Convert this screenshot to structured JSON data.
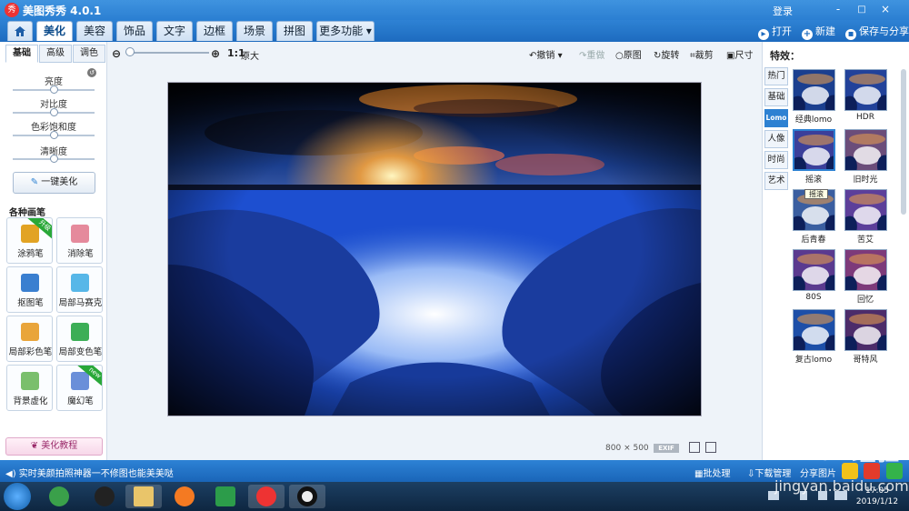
{
  "app": {
    "title": "美图秀秀 4.0.1",
    "logo": "秀",
    "login": "登录",
    "window_controls": [
      "-",
      "□",
      "×"
    ]
  },
  "topbar": {
    "tabs": [
      "美化",
      "美容",
      "饰品",
      "文字",
      "边框",
      "场景",
      "拼图",
      "更多功能 ▾"
    ],
    "active_tab": "美化",
    "open": "打开",
    "new": "新建",
    "save_share": "保存与分享"
  },
  "left": {
    "subtabs": [
      "基础",
      "高级",
      "调色"
    ],
    "sliders": [
      {
        "label": "亮度",
        "value": 0.5
      },
      {
        "label": "对比度",
        "value": 0.5
      },
      {
        "label": "色彩饱和度",
        "value": 0.5
      },
      {
        "label": "清晰度",
        "value": 0.5
      }
    ],
    "onekey": "一键美化",
    "brush_header": "各种画笔",
    "tools": [
      {
        "label": "涂鸦笔",
        "badge": "升级",
        "color": "#e2a324"
      },
      {
        "label": "消除笔",
        "badge": "",
        "color": "#e58a9c"
      },
      {
        "label": "抠图笔",
        "badge": "",
        "color": "#3a7fd0"
      },
      {
        "label": "局部马赛克",
        "badge": "",
        "color": "#57b7e8"
      },
      {
        "label": "局部彩色笔",
        "badge": "",
        "color": "#e9a53a"
      },
      {
        "label": "局部变色笔",
        "badge": "",
        "color": "#3cae56"
      },
      {
        "label": "背景虚化",
        "badge": "",
        "color": "#7abf6c"
      },
      {
        "label": "魔幻笔",
        "badge": "new",
        "color": "#6a8fd9"
      }
    ],
    "tutorial": "美化教程"
  },
  "canvas": {
    "zoom_ratio": "1:1",
    "zoom_label": "原大",
    "undo": "撤销",
    "redo": "重做",
    "original": "原图",
    "rotate": "旋转",
    "crop": "裁剪",
    "resize": "尺寸",
    "width": "800",
    "times": "×",
    "height": "500",
    "exif": "EXIF"
  },
  "effects": {
    "title": "特效：",
    "categories": [
      "热门",
      "基础",
      "Lomo",
      "人像",
      "时尚",
      "艺术"
    ],
    "active_category": "Lomo",
    "thumbs": [
      {
        "label": "经典lomo",
        "tint": "#1b3f8f"
      },
      {
        "label": "HDR",
        "tint": "#22429a"
      },
      {
        "label": "摇滚",
        "tint": "#3b3f9a"
      },
      {
        "label": "旧时光",
        "tint": "#6b4d7a"
      },
      {
        "label": "后青春",
        "tint": "#3a5ea0"
      },
      {
        "label": "苦艾",
        "tint": "#5c3f9a"
      },
      {
        "label": "80S",
        "tint": "#5a3a8f"
      },
      {
        "label": "回忆",
        "tint": "#7d3a7a"
      },
      {
        "label": "复古lomo",
        "tint": "#1d4fa8"
      },
      {
        "label": "哥特风",
        "tint": "#4c2c6a"
      }
    ],
    "selected": "摇滚",
    "tooltip": "摇滚"
  },
  "status": {
    "message": "实时美颜拍照神器一不修图也能美美哒",
    "batch": "批处理",
    "download": "下载管理",
    "share": "分享图片"
  },
  "taskbar": {
    "time": "17:05",
    "date": "2019/1/12"
  },
  "watermark": {
    "text": "Bai 经验",
    "url": "jingyan.baidu.com"
  }
}
